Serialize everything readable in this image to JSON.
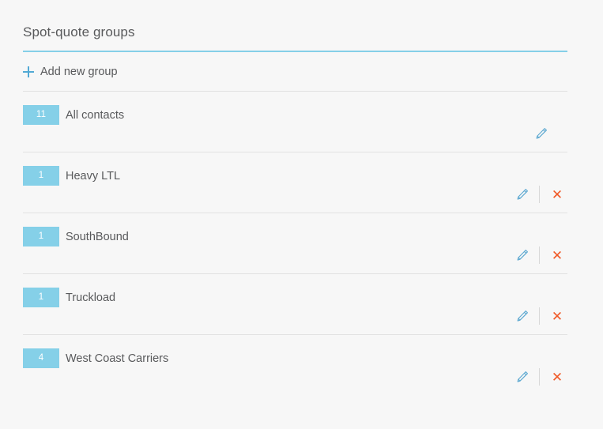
{
  "header": {
    "title": "Spot-quote groups"
  },
  "add_action": {
    "icon": "plus-icon",
    "label": "Add new group"
  },
  "icons": {
    "edit": "pencil-icon",
    "delete": "close-icon"
  },
  "colors": {
    "badge": "#85d0e8",
    "accent_underline": "#85cfe8",
    "plus": "#52a9d4",
    "edit_icon": "#5aa7d0",
    "delete_icon": "#f05a28",
    "text": "#58595b",
    "background": "#f7f7f7",
    "divider": "#e2e2e2"
  },
  "groups": [
    {
      "count": "11",
      "name": "All contacts",
      "editable": true,
      "deletable": false
    },
    {
      "count": "1",
      "name": "Heavy LTL",
      "editable": true,
      "deletable": true
    },
    {
      "count": "1",
      "name": "SouthBound",
      "editable": true,
      "deletable": true
    },
    {
      "count": "1",
      "name": "Truckload",
      "editable": true,
      "deletable": true
    },
    {
      "count": "4",
      "name": "West Coast Carriers",
      "editable": true,
      "deletable": true
    }
  ]
}
